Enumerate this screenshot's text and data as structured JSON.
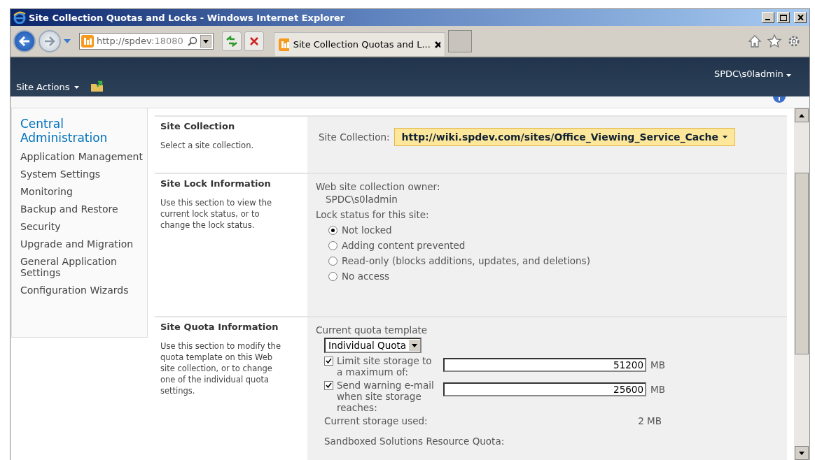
{
  "window": {
    "title": "Site Collection Quotas and Locks - Windows Internet Explorer"
  },
  "browser": {
    "address_host": "http://spdev",
    "address_port": ":18080",
    "tab_title": "Site Collection Quotas and L..."
  },
  "header": {
    "site_actions": "Site Actions",
    "user": "SPDC\\s0ladmin"
  },
  "sidebar": {
    "title": "Central Administration",
    "items": [
      "Application Management",
      "System Settings",
      "Monitoring",
      "Backup and Restore",
      "Security",
      "Upgrade and Migration",
      "General Application Settings",
      "Configuration Wizards"
    ]
  },
  "sections": [
    {
      "kind": "collection",
      "title": "Site Collection",
      "description": "Select a site collection.",
      "label": "Site Collection:",
      "value": "http://wiki.spdev.com/sites/Office_Viewing_Service_Cache"
    },
    {
      "kind": "lock",
      "title": "Site Lock Information",
      "description": "Use this section to view the current lock status, or to change the lock status.",
      "owner_label": "Web site collection owner:",
      "owner": "SPDC\\s0ladmin",
      "status_label": "Lock status for this site:",
      "options": [
        {
          "label": "Not locked",
          "selected": true
        },
        {
          "label": "Adding content prevented",
          "selected": false
        },
        {
          "label": "Read-only (blocks additions, updates, and deletions)",
          "selected": false
        },
        {
          "label": "No access",
          "selected": false
        }
      ]
    },
    {
      "kind": "quota",
      "title": "Site Quota Information",
      "description": "Use this section to modify the quota template on this Web site collection, or to change one of the individual quota settings.",
      "template_label": "Current quota template",
      "template": "Individual Quota",
      "limits": [
        {
          "label": "Limit site storage to a maximum of:",
          "checked": true,
          "value": "51200",
          "unit": "MB"
        },
        {
          "label": "Send warning e-mail when site storage reaches:",
          "checked": true,
          "value": "25600",
          "unit": "MB"
        }
      ],
      "used_label": "Current storage used:",
      "used": "2 MB",
      "next_label": "Sandboxed Solutions Resource Quota:"
    }
  ]
}
